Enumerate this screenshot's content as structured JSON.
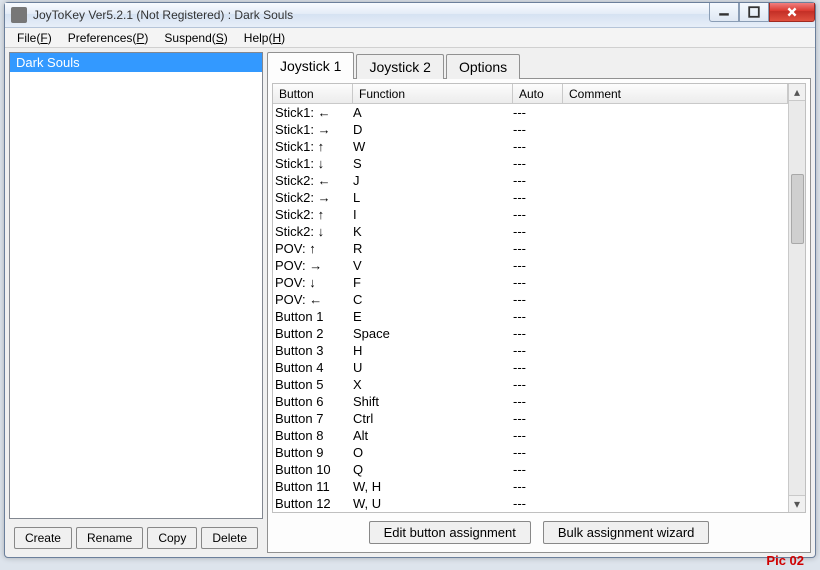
{
  "window": {
    "title": "JoyToKey Ver5.2.1 (Not Registered) : Dark Souls"
  },
  "menu": {
    "file": "File(",
    "file_u": "F",
    "file_end": ")",
    "prefs": "Preferences(",
    "prefs_u": "P",
    "prefs_end": ")",
    "suspend": "Suspend(",
    "suspend_u": "S",
    "suspend_end": ")",
    "help": "Help(",
    "help_u": "H",
    "help_end": ")"
  },
  "profiles": [
    "Dark Souls"
  ],
  "left_buttons": {
    "create": "Create",
    "rename": "Rename",
    "copy": "Copy",
    "delete": "Delete"
  },
  "tabs": {
    "joy1": "Joystick 1",
    "joy2": "Joystick 2",
    "options": "Options"
  },
  "columns": {
    "button": "Button",
    "function": "Function",
    "auto": "Auto",
    "comment": "Comment"
  },
  "rows": [
    {
      "button": "Stick1: ←",
      "func": "A",
      "auto": "---",
      "comment": ""
    },
    {
      "button": "Stick1: →",
      "func": "D",
      "auto": "---",
      "comment": ""
    },
    {
      "button": "Stick1: ↑",
      "func": "W",
      "auto": "---",
      "comment": ""
    },
    {
      "button": "Stick1: ↓",
      "func": "S",
      "auto": "---",
      "comment": ""
    },
    {
      "button": "Stick2: ←",
      "func": "J",
      "auto": "---",
      "comment": ""
    },
    {
      "button": "Stick2: →",
      "func": "L",
      "auto": "---",
      "comment": ""
    },
    {
      "button": "Stick2: ↑",
      "func": "I",
      "auto": "---",
      "comment": ""
    },
    {
      "button": "Stick2: ↓",
      "func": "K",
      "auto": "---",
      "comment": ""
    },
    {
      "button": "POV: ↑",
      "func": "R",
      "auto": "---",
      "comment": ""
    },
    {
      "button": "POV: →",
      "func": "V",
      "auto": "---",
      "comment": ""
    },
    {
      "button": "POV: ↓",
      "func": "F",
      "auto": "---",
      "comment": ""
    },
    {
      "button": "POV: ←",
      "func": "C",
      "auto": "---",
      "comment": ""
    },
    {
      "button": "Button 1",
      "func": "E",
      "auto": "---",
      "comment": ""
    },
    {
      "button": "Button 2",
      "func": "Space",
      "auto": "---",
      "comment": ""
    },
    {
      "button": "Button 3",
      "func": "H",
      "auto": "---",
      "comment": ""
    },
    {
      "button": "Button 4",
      "func": "U",
      "auto": "---",
      "comment": ""
    },
    {
      "button": "Button 5",
      "func": "X",
      "auto": "---",
      "comment": ""
    },
    {
      "button": "Button 6",
      "func": "Shift",
      "auto": "---",
      "comment": ""
    },
    {
      "button": "Button 7",
      "func": "Ctrl",
      "auto": "---",
      "comment": ""
    },
    {
      "button": "Button 8",
      "func": "Alt",
      "auto": "---",
      "comment": ""
    },
    {
      "button": "Button 9",
      "func": "O",
      "auto": "---",
      "comment": ""
    },
    {
      "button": "Button 10",
      "func": "Q",
      "auto": "---",
      "comment": ""
    },
    {
      "button": "Button 11",
      "func": "W, H",
      "auto": "---",
      "comment": ""
    },
    {
      "button": "Button 12",
      "func": "W, U",
      "auto": "---",
      "comment": ""
    }
  ],
  "bottom_buttons": {
    "edit": "Edit button assignment",
    "bulk": "Bulk assignment wizard"
  },
  "caption": "Pic 02"
}
